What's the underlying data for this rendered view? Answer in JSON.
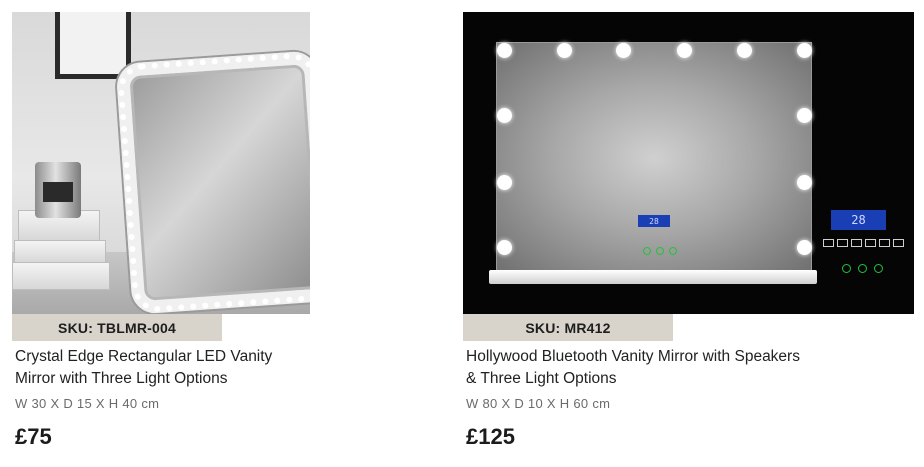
{
  "products": [
    {
      "sku": "SKU: TBLMR-004",
      "title_line1": "Crystal Edge Rectangular LED Vanity",
      "title_line2": "Mirror with Three Light Options",
      "dimensions": "W 30 X D 15 X H 40 cm",
      "price": "£75",
      "image_alt": "crystal-edge-mirror-photo"
    },
    {
      "sku": "SKU: MR412",
      "title_line1": "Hollywood Bluetooth Vanity Mirror with Speakers",
      "title_line2": "& Three Light Options",
      "dimensions": "W 80 X D 10 X H 60 cm",
      "price": "£125",
      "image_alt": "hollywood-bluetooth-mirror-photo",
      "display_small": "28",
      "display_large": "28"
    }
  ],
  "colors": {
    "sku_badge_bg": "#d8d3cb",
    "price_text": "#1c1c1c",
    "dims_text": "#6b6b6b"
  }
}
